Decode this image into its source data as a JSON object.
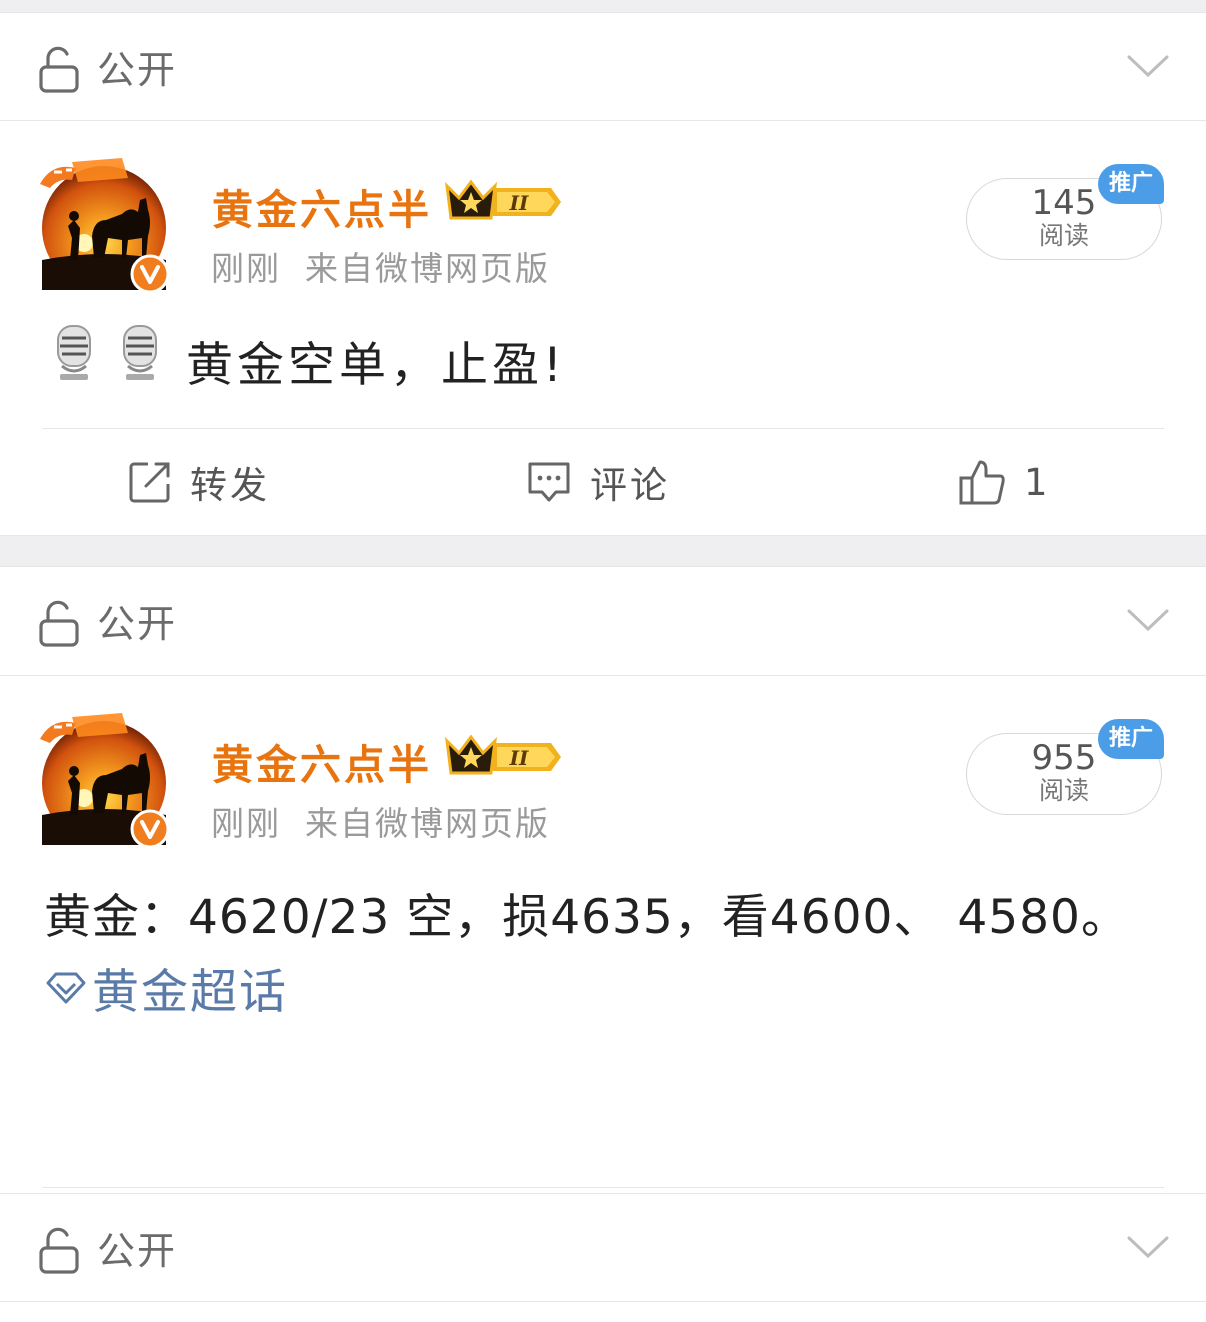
{
  "visibility_label": "公开",
  "posts": [
    {
      "author": "黄金六点半",
      "crown_level": "II",
      "time": "刚刚",
      "source": "来自微博网页版",
      "reads": "145",
      "reads_label": "阅读",
      "promo": "推广",
      "text": "黄金空单，止盈!",
      "actions": {
        "repost": "转发",
        "comment": "评论",
        "like_count": "1"
      }
    },
    {
      "author": "黄金六点半",
      "crown_level": "II",
      "time": "刚刚",
      "source": "来自微博网页版",
      "reads": "955",
      "reads_label": "阅读",
      "promo": "推广",
      "text": "黄金：4620/23 空，损4635，看4600、 4580。",
      "topic": "黄金超话"
    }
  ],
  "colors": {
    "author": "#e8740f",
    "topic": "#5a7aa8",
    "promo": "#4b9de8",
    "verified": "#f07d1e"
  }
}
